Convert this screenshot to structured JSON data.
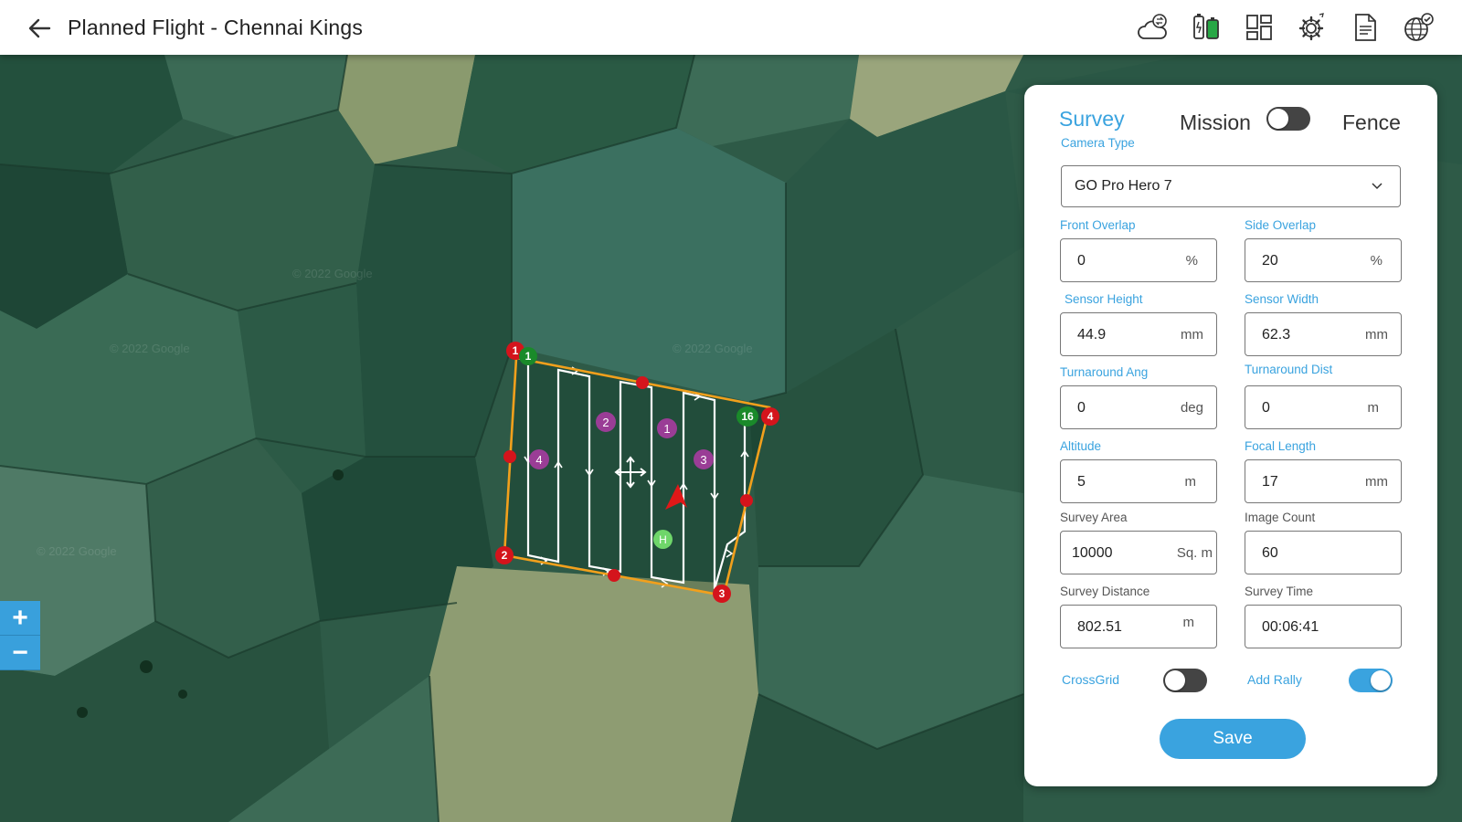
{
  "header": {
    "title": "Planned Flight - Chennai Kings",
    "back_icon": "arrow-left-icon",
    "tools": [
      {
        "name": "weather-sync-icon"
      },
      {
        "name": "battery-icon"
      },
      {
        "name": "layout-icon"
      },
      {
        "name": "settings-icon"
      },
      {
        "name": "document-icon"
      },
      {
        "name": "globe-check-icon"
      }
    ]
  },
  "map": {
    "vertex_labels": [
      "1",
      "2",
      "3",
      "4"
    ],
    "start_waypoint": "1",
    "end_waypoint": "16",
    "rally_labels": [
      "1",
      "2",
      "3",
      "4"
    ],
    "home_label": "H",
    "watermark": "© 2022 Google"
  },
  "zoom": {
    "in_label": "+",
    "out_label": "−"
  },
  "panel": {
    "mode_survey": "Survey",
    "mode_mission": "Mission",
    "mode_fence": "Fence",
    "camera_type_label": "Camera Type",
    "camera_type_value": "GO Pro Hero 7",
    "fields": {
      "front_overlap": {
        "label": "Front Overlap",
        "value": "0",
        "unit": "%"
      },
      "side_overlap": {
        "label": "Side Overlap",
        "value": "20",
        "unit": "%"
      },
      "sensor_height": {
        "label": "Sensor Height",
        "value": "44.9",
        "unit": "mm"
      },
      "sensor_width": {
        "label": "Sensor Width",
        "value": "62.3",
        "unit": "mm"
      },
      "turnaround_ang": {
        "label": "Turnaround Ang",
        "value": "0",
        "unit": "deg"
      },
      "turnaround_dist": {
        "label": "Turnaround Dist",
        "value": "0",
        "unit": "m"
      },
      "altitude": {
        "label": "Altitude",
        "value": "5",
        "unit": "m"
      },
      "focal_length": {
        "label": "Focal Length",
        "value": "17",
        "unit": "mm"
      },
      "survey_area": {
        "label": "Survey Area",
        "value": "10000",
        "unit": "Sq. m"
      },
      "image_count": {
        "label": "Image Count",
        "value": "60",
        "unit": ""
      },
      "survey_distance": {
        "label": "Survey Distance",
        "value": "802.51",
        "unit": "m"
      },
      "survey_time": {
        "label": "Survey Time",
        "value": "00:06:41",
        "unit": ""
      }
    },
    "crossgrid_label": "CrossGrid",
    "crossgrid_on": false,
    "add_rally_label": "Add Rally",
    "add_rally_on": true,
    "mission_toggle_on": false,
    "save_label": "Save",
    "accent_color": "#3aa3df"
  }
}
